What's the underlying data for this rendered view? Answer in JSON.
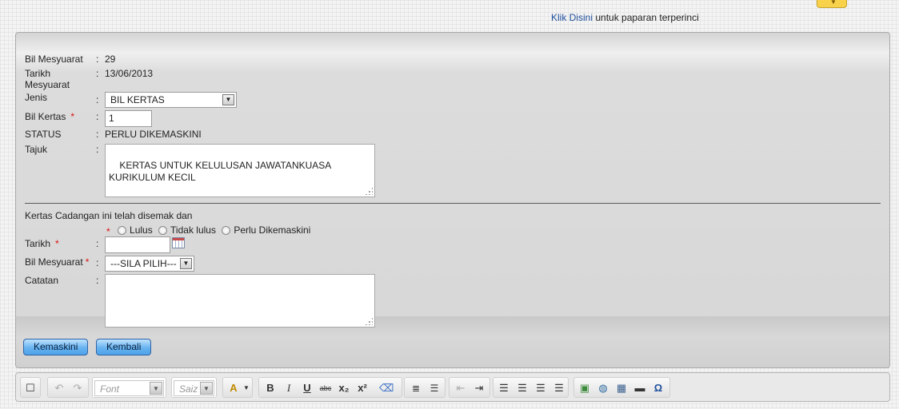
{
  "top": {
    "link_text": "Klik Disini",
    "link_suffix": " untuk paparan terperinci"
  },
  "form": {
    "bil_mesyuarat_label": "Bil Mesyuarat",
    "bil_mesyuarat_value": "29",
    "tarikh_mesyuarat_label": "Tarikh Mesyuarat",
    "tarikh_mesyuarat_value": "13/06/2013",
    "jenis_label": "Jenis",
    "jenis_value": "BIL KERTAS",
    "bil_kertas_label": "Bil Kertas",
    "bil_kertas_value": "1",
    "status_label": "STATUS",
    "status_value": "PERLU DIKEMASKINI",
    "tajuk_label": "Tajuk",
    "tajuk_value": "KERTAS UNTUK KELULUSAN JAWATANKUASA\nKURIKULUM KECIL",
    "colon": ":",
    "required_mark": "*"
  },
  "review": {
    "statement": "Kertas Cadangan ini telah disemak dan",
    "options": [
      "Lulus",
      "Tidak lulus",
      "Perlu Dikemaskini"
    ],
    "tarikh_label": "Tarikh",
    "tarikh_value": "",
    "bil_mesyuarat_label": "Bil Mesyuarat",
    "bil_mesyuarat_value": "---SILA PILIH---",
    "catatan_label": "Catatan",
    "catatan_value": ""
  },
  "buttons": {
    "update": "Kemaskini",
    "back": "Kembali"
  },
  "editor": {
    "font_placeholder": "Font",
    "size_placeholder": "Saiz"
  }
}
